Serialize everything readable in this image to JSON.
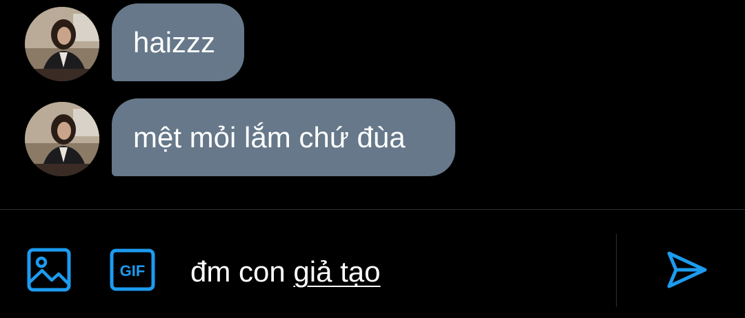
{
  "conversation": {
    "messages": [
      {
        "text": "haizzz",
        "sender": "other"
      },
      {
        "text": "mệt mỏi lắm chứ đùa",
        "sender": "other"
      }
    ]
  },
  "composer": {
    "text_plain": "đm con ",
    "text_underlined": "giả tạo",
    "media_icon": "image-icon",
    "gif_icon": "gif-icon",
    "gif_label": "GIF",
    "send_icon": "send-icon"
  },
  "colors": {
    "background": "#000000",
    "bubble": "#66788a",
    "accent": "#1d9bf0",
    "divider": "#2b3036",
    "text": "#ffffff"
  }
}
